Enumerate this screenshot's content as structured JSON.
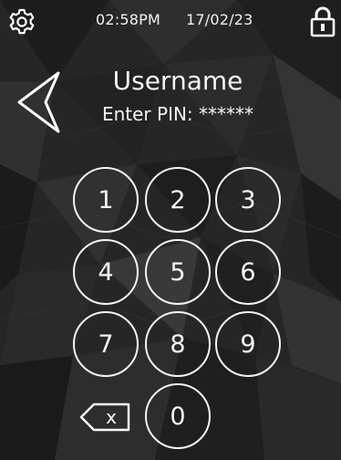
{
  "status_bar": {
    "time": "02:58PM",
    "date": "17/02/23",
    "settings_icon": "gear-icon",
    "lock_icon": "padlock-icon"
  },
  "header": {
    "back_icon": "back-arrow-icon",
    "username": "Username",
    "pin_prompt": "Enter PIN: ******"
  },
  "keypad": {
    "keys": [
      "1",
      "2",
      "3",
      "4",
      "5",
      "6",
      "7",
      "8",
      "9",
      "0"
    ],
    "backspace_icon": "backspace-icon",
    "backspace_glyph": "x"
  },
  "colors": {
    "background": "#242424",
    "foreground": "#ffffff"
  }
}
